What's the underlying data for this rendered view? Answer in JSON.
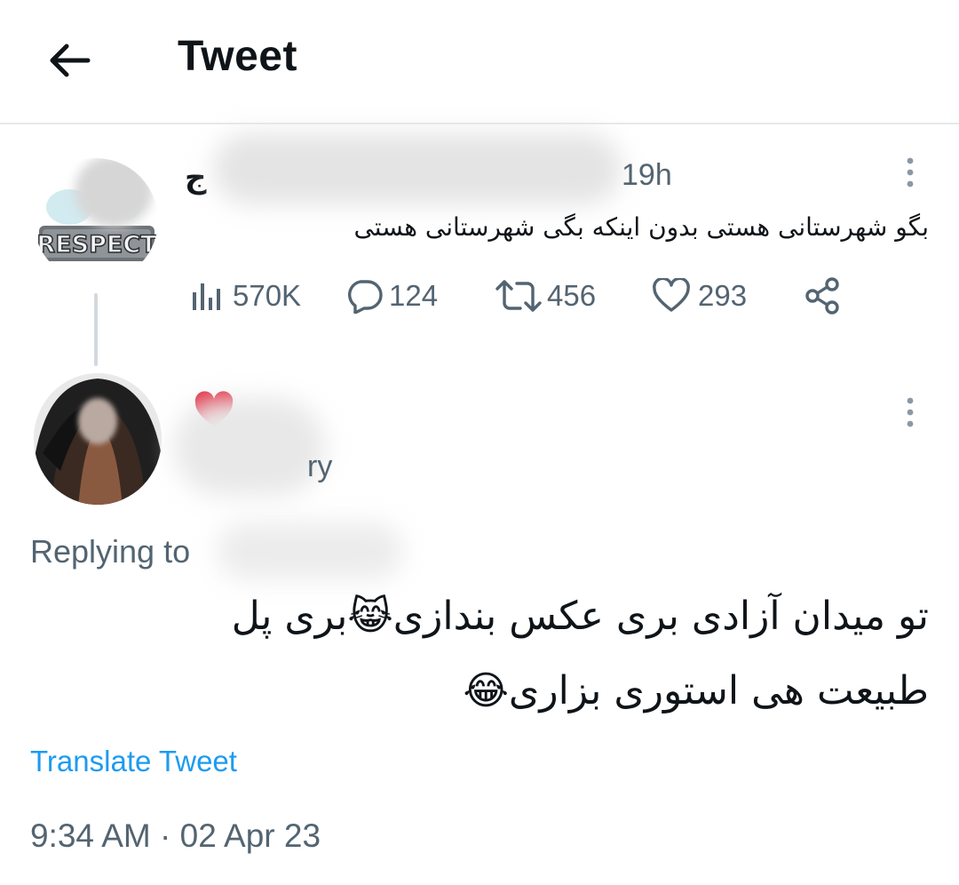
{
  "header": {
    "title": "Tweet",
    "back_icon": "arrow-left-icon"
  },
  "parent_tweet": {
    "author_initial": "ج",
    "time": "19h",
    "avatar_text": "RESPECT",
    "text": "بگو شهرستانی هستی بدون اینکه بگی شهرستانی هستی",
    "stats": {
      "views": "570K",
      "replies": "124",
      "retweets": "456",
      "likes": "293"
    }
  },
  "reply_tweet": {
    "handle_fragment": "ry",
    "replying_label": "Replying to",
    "text_line1": "تو میدان آزادی بری عکس بندازی😹بری پل",
    "text_line2": "طبیعت هی استوری بزاری😂",
    "translate_label": "Translate Tweet",
    "timestamp": "9:34 AM · 02 Apr 23"
  },
  "colors": {
    "accent": "#1d9bf0",
    "muted": "#536471",
    "text": "#0f1419",
    "divider": "#e6e9eb"
  }
}
